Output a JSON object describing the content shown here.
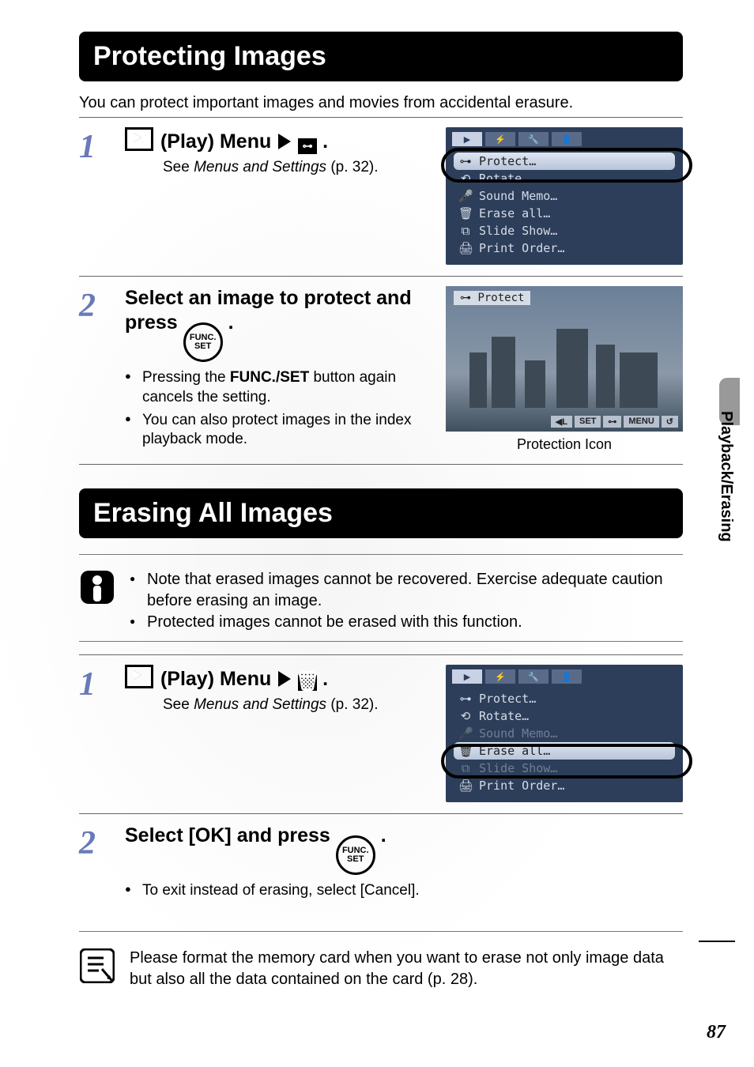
{
  "side_tab": "Playback/Erasing",
  "page_number": "87",
  "protecting": {
    "heading": "Protecting Images",
    "intro": "You can protect important images and movies from accidental erasure.",
    "step1": {
      "title_prefix": " (Play) Menu",
      "see_text": "See ",
      "see_italic": "Menus and Settings",
      "see_suffix": " (p. 32).",
      "menu_items": [
        "Protect…",
        "Rotate…",
        "Sound Memo…",
        "Erase all…",
        "Slide Show…",
        "Print Order…"
      ],
      "highlighted": "Protect…"
    },
    "step2": {
      "title_a": "Select an image to protect and press ",
      "bullets": [
        "Pressing the FUNC./SET button again cancels the setting.",
        "You can also protect images in the index playback mode."
      ],
      "screen_label": "Protect",
      "bar_chips": [
        "◀L",
        "SET",
        "⊶",
        "MENU",
        "↺"
      ],
      "caption": "Protection Icon"
    }
  },
  "erasing": {
    "heading": "Erasing All Images",
    "warnings": [
      "Note that erased images cannot be recovered. Exercise adequate caution before erasing an image.",
      "Protected images cannot be erased with this function."
    ],
    "step1": {
      "title_prefix": " (Play) Menu",
      "see_text": "See ",
      "see_italic": "Menus and Settings",
      "see_suffix": " (p. 32).",
      "menu_items": [
        "Protect…",
        "Rotate…",
        "Sound Memo…",
        "Erase all…",
        "Slide Show…",
        "Print Order…"
      ],
      "highlighted": "Erase all…"
    },
    "step2": {
      "title": "Select [OK] and press ",
      "bullet": "To exit instead of erasing, select [Cancel]."
    },
    "info": "Please format the memory card when you want to erase not only image data but also all the data contained on the card (p. 28)."
  },
  "func_label_top": "FUNC.",
  "func_label_bottom": "SET"
}
